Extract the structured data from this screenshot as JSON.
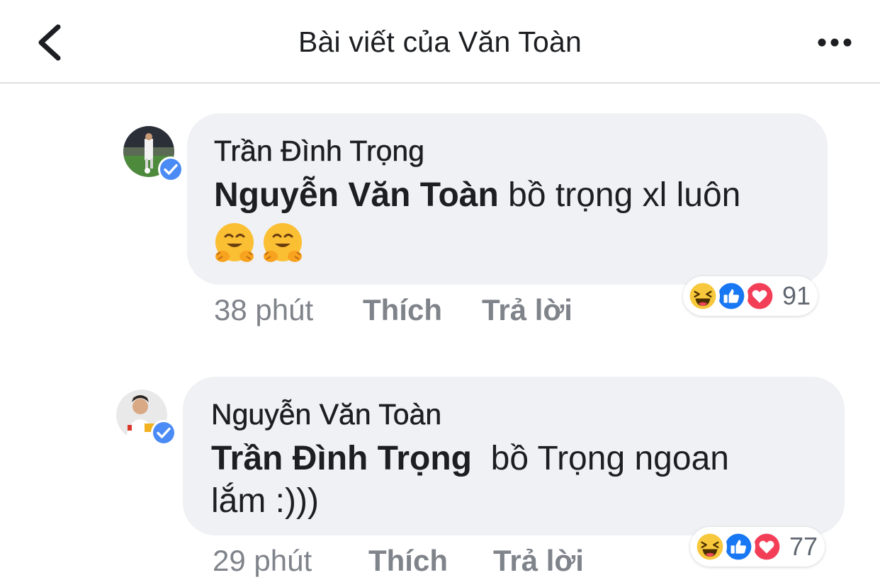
{
  "header": {
    "title": "Bài viết của Văn Toàn"
  },
  "comments": [
    {
      "author": "Trần Đình Trọng",
      "mention": "Nguyễn Văn Toàn",
      "text_line1": " bồ trọng xl luôn",
      "text_line2": "",
      "emoji": [
        "hugging-face",
        "hugging-face"
      ],
      "time": "38 phút",
      "like_label": "Thích",
      "reply_label": "Trả lời",
      "reactions": [
        "haha",
        "like",
        "love"
      ],
      "reaction_count": "91"
    },
    {
      "author": "Nguyễn Văn Toàn",
      "mention": "Trần Đình Trọng",
      "text_line1": "  bồ Trọng ngoan",
      "text_line2": "lắm :)))",
      "emoji": [],
      "time": "29 phút",
      "like_label": "Thích",
      "reply_label": "Trả lời",
      "reactions": [
        "haha",
        "like",
        "love"
      ],
      "reaction_count": "77"
    }
  ],
  "colors": {
    "like_blue": "#1877f2",
    "love_red": "#f33e58",
    "haha_yellow": "#f7c83b",
    "verified_blue": "#4b8bf5",
    "bubble_bg": "#f0f1f4",
    "meta_gray": "#7f838a"
  }
}
